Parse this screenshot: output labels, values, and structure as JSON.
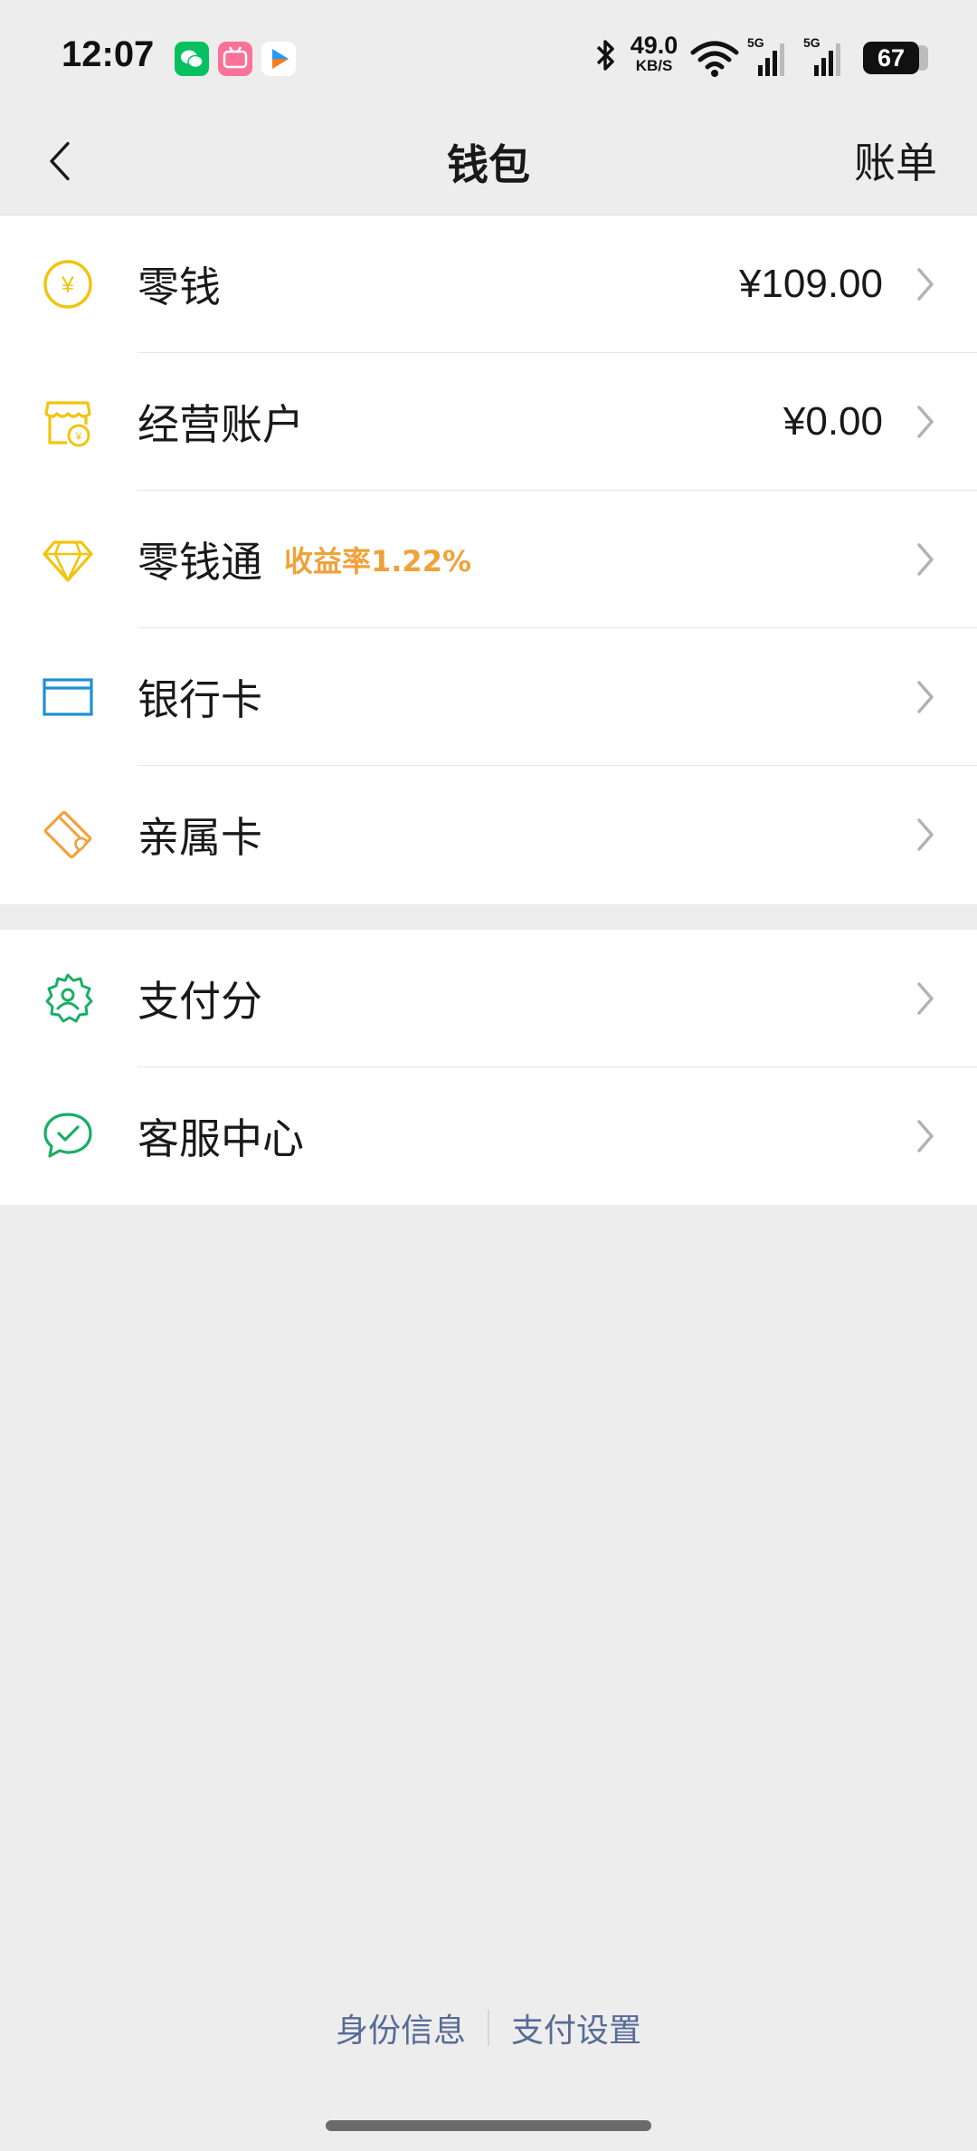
{
  "status_bar": {
    "time": "12:07",
    "net_speed_value": "49.0",
    "net_speed_unit": "KB/S",
    "signal1_label": "5G",
    "signal2_label": "5G",
    "battery": "67"
  },
  "nav": {
    "title": "钱包",
    "right_label": "账单"
  },
  "group1": [
    {
      "label": "零钱",
      "value": "¥109.00",
      "icon": "yuan-coin-icon",
      "color": "#f1c40f"
    },
    {
      "label": "经营账户",
      "value": "¥0.00",
      "icon": "store-icon",
      "color": "#f1c40f"
    },
    {
      "label": "零钱通",
      "tag": "收益率1.22%",
      "icon": "diamond-icon",
      "color": "#f1c40f"
    },
    {
      "label": "银行卡",
      "icon": "bank-card-icon",
      "color": "#1f8fd6"
    },
    {
      "label": "亲属卡",
      "icon": "family-card-icon",
      "color": "#f0a23a"
    }
  ],
  "group2": [
    {
      "label": "支付分",
      "icon": "pay-score-icon",
      "color": "#1aad65"
    },
    {
      "label": "客服中心",
      "icon": "service-icon",
      "color": "#1aad65"
    }
  ],
  "footer": {
    "identity": "身份信息",
    "settings": "支付设置"
  },
  "colors": {
    "background": "#ededed",
    "link": "#576b95",
    "tag": "#f0a23a"
  }
}
